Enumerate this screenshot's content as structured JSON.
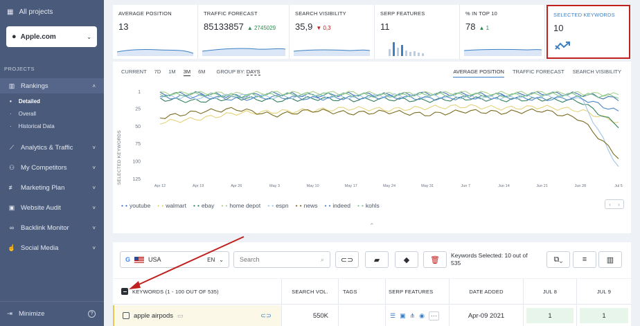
{
  "sidebar": {
    "all_projects": "All projects",
    "project_name": "Apple.com",
    "section_label": "PROJECTS",
    "items": [
      {
        "label": "Rankings",
        "icon": "bar-chart-icon"
      },
      {
        "label": "Analytics & Traffic",
        "icon": "analytics-icon"
      },
      {
        "label": "My Competitors",
        "icon": "competitors-icon"
      },
      {
        "label": "Marketing Plan",
        "icon": "marketing-plan-icon"
      },
      {
        "label": "Website Audit",
        "icon": "audit-icon"
      },
      {
        "label": "Backlink Monitor",
        "icon": "link-icon"
      },
      {
        "label": "Social Media",
        "icon": "thumbs-up-icon"
      }
    ],
    "sub_items": [
      "Detailed",
      "Overall",
      "Historical Data"
    ],
    "minimize": "Minimize"
  },
  "cards": [
    {
      "title": "AVERAGE POSITION",
      "value": "13",
      "delta": ""
    },
    {
      "title": "TRAFFIC FORECAST",
      "value": "85133857",
      "delta": "▲ 2745029"
    },
    {
      "title": "SEARCH VISIBILITY",
      "value": "35,9",
      "delta": "▼ 0,3"
    },
    {
      "title": "SERP FEATURES",
      "value": "11",
      "delta": ""
    },
    {
      "title": "% IN TOP 10",
      "value": "78",
      "delta": "▲ 1"
    },
    {
      "title": "SELECTED KEYWORDS",
      "value": "10",
      "delta": ""
    }
  ],
  "chart_tabs": {
    "periods": [
      "CURRENT",
      "7D",
      "1M",
      "3M",
      "6M"
    ],
    "active_period": "3M",
    "group_by_label": "GROUP BY:",
    "group_by_value": "DAYS",
    "views": [
      "AVERAGE POSITION",
      "TRAFFIC FORECAST",
      "SEARCH VISIBILITY"
    ],
    "active_view": "AVERAGE POSITION"
  },
  "chart_data": {
    "type": "line",
    "ylabel": "SELECTED KEYWORDS",
    "y_ticks": [
      "1",
      "25",
      "50",
      "75",
      "100",
      "125"
    ],
    "ylim": [
      125,
      1
    ],
    "x_ticks": [
      "Apr 12",
      "Apr 19",
      "Apr 26",
      "May 3",
      "May 10",
      "May 17",
      "May 24",
      "May 31",
      "Jun 7",
      "Jun 14",
      "Jun 21",
      "Jun 28",
      "Jul 5"
    ],
    "series": [
      {
        "name": "youtube",
        "color": "#3f6fb5",
        "values": [
          5,
          4,
          8,
          4,
          7,
          5,
          6,
          4,
          5,
          6,
          4,
          5,
          12
        ]
      },
      {
        "name": "walmart",
        "color": "#e4d27a",
        "values": [
          45,
          40,
          32,
          30,
          28,
          25,
          27,
          24,
          22,
          25,
          23,
          28,
          45
        ]
      },
      {
        "name": "ebay",
        "color": "#2f7f5a",
        "values": [
          12,
          15,
          10,
          14,
          11,
          13,
          12,
          14,
          11,
          13,
          12,
          15,
          50
        ]
      },
      {
        "name": "home depot",
        "color": "#a9d18e",
        "values": [
          4,
          3,
          5,
          3,
          4,
          3,
          5,
          4,
          3,
          4,
          3,
          4,
          6
        ]
      },
      {
        "name": "espn",
        "color": "#9ec5ea",
        "values": [
          8,
          10,
          7,
          9,
          8,
          9,
          7,
          8,
          9,
          10,
          8,
          9,
          110
        ]
      },
      {
        "name": "news",
        "color": "#7a6b1f",
        "values": [
          38,
          30,
          26,
          35,
          28,
          32,
          30,
          34,
          29,
          31,
          28,
          40,
          95
        ]
      },
      {
        "name": "indeed",
        "color": "#4f87c7",
        "values": [
          10,
          8,
          12,
          9,
          11,
          10,
          9,
          11,
          10,
          9,
          12,
          10,
          30
        ]
      },
      {
        "name": "kohls",
        "color": "#7fc48a",
        "values": [
          6,
          5,
          7,
          6,
          5,
          6,
          7,
          5,
          6,
          7,
          5,
          6,
          8
        ]
      }
    ],
    "grid": false,
    "legend": "bottom"
  },
  "toolbar": {
    "engine": "Google",
    "country": "USA",
    "language": "EN",
    "search_placeholder": "Search",
    "selected_text": "Keywords Selected: 10 out of 535"
  },
  "table": {
    "headers": {
      "keywords": "KEYWORDS (1 - 100 OUT OF 535)",
      "search_vol": "SEARCH VOL.",
      "tags": "TAGS",
      "serp": "SERP FEATURES",
      "date_added": "DATE ADDED",
      "jul8": "JUL 8",
      "jul9": "JUL 9"
    },
    "rows": [
      {
        "keyword": "apple airpods",
        "search_vol": "550K",
        "date_added": "Apr-09 2021",
        "jul8": "1",
        "jul9": "1"
      }
    ]
  }
}
